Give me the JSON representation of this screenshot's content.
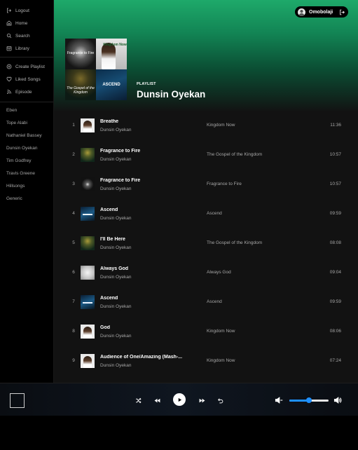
{
  "sidebar": {
    "nav_top": [
      {
        "label": "Logout",
        "icon": "logout-icon"
      },
      {
        "label": "Home",
        "icon": "home-icon"
      },
      {
        "label": "Search",
        "icon": "search-icon"
      },
      {
        "label": "Library",
        "icon": "library-icon"
      }
    ],
    "nav_bottom": [
      {
        "label": "Create Playlist",
        "icon": "plus-circle-icon"
      },
      {
        "label": "Liked Songs",
        "icon": "heart-icon"
      },
      {
        "label": "Episode",
        "icon": "rss-icon"
      }
    ],
    "artists": [
      "Eben",
      "Tope Alabi",
      "Nathaniel Bassey",
      "Dunsin Oyekan",
      "Tim Godfrey",
      "Travis Greene",
      "Hillsongs",
      "Generic"
    ]
  },
  "header": {
    "user_name": "Omobolaji",
    "accent_color": "#1ea96a",
    "cover_tiles": [
      {
        "label": "Fragrance to Fire",
        "icon": "album-fragrance-to-fire"
      },
      {
        "label": "Kingdom Now",
        "icon": "album-kingdom-now"
      },
      {
        "label": "The Gospel of the Kingdom",
        "icon": "album-gospel-of-the-kingdom"
      },
      {
        "label": "ASCEND",
        "icon": "album-ascend"
      }
    ],
    "playlist_type": "PLAYLIST",
    "playlist_title": "Dunsin Oyekan"
  },
  "tracks": [
    {
      "num": "1",
      "title": "Breathe",
      "artist": "Dunsin Oyekan",
      "album": "Kingdom Now",
      "duration": "11:36",
      "art": "face"
    },
    {
      "num": "2",
      "title": "Fragrance to Fire",
      "artist": "Dunsin Oyekan",
      "album": "The Gospel of the Kingdom",
      "duration": "10:57",
      "art": "gospel"
    },
    {
      "num": "3",
      "title": "Fragrance to Fire",
      "artist": "Dunsin Oyekan",
      "album": "Fragrance to Fire",
      "duration": "10:57",
      "art": "fire"
    },
    {
      "num": "4",
      "title": "Ascend",
      "artist": "Dunsin Oyekan",
      "album": "Ascend",
      "duration": "09:59",
      "art": "ascend"
    },
    {
      "num": "5",
      "title": "I'll Be Here",
      "artist": "Dunsin Oyekan",
      "album": "The Gospel of the Kingdom",
      "duration": "08:08",
      "art": "gospel"
    },
    {
      "num": "6",
      "title": "Always God",
      "artist": "Dunsin Oyekan",
      "album": "Always God",
      "duration": "09:04",
      "art": "always"
    },
    {
      "num": "7",
      "title": "Ascend",
      "artist": "Dunsin Oyekan",
      "album": "Ascend",
      "duration": "09:59",
      "art": "ascend"
    },
    {
      "num": "8",
      "title": "God",
      "artist": "Dunsin Oyekan",
      "album": "Kingdom Now",
      "duration": "08:06",
      "art": "face"
    },
    {
      "num": "9",
      "title": "Audience of One/Amazing (Mash-...",
      "artist": "Dunsin Oyekan",
      "album": "Kingdom Now",
      "duration": "07:24",
      "art": "face"
    }
  ],
  "player": {
    "volume_fraction": 0.5,
    "volume_color": "#1e90ff",
    "controls": [
      "shuffle-icon",
      "previous-icon",
      "play-icon",
      "next-icon",
      "repeat-icon"
    ]
  }
}
